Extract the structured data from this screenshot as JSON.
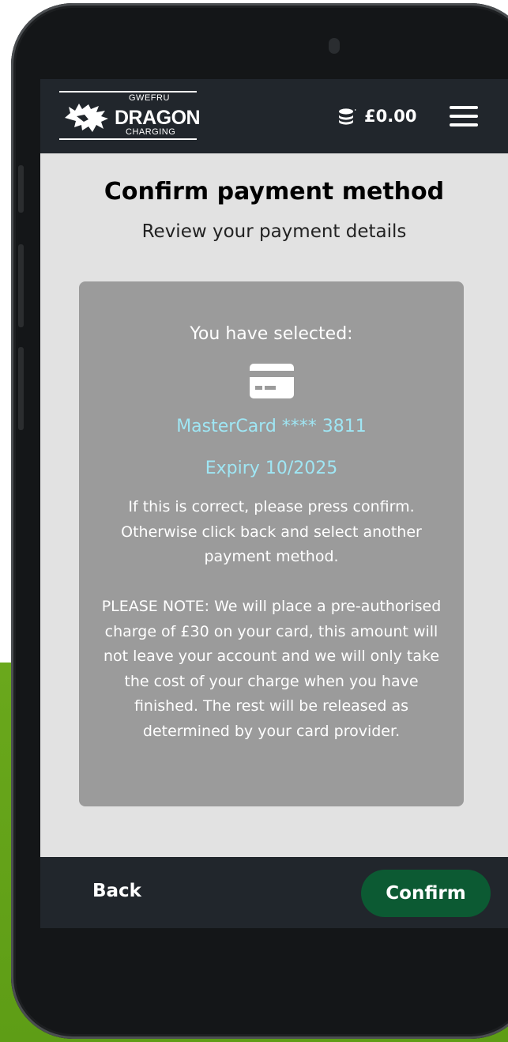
{
  "header": {
    "logo_top": "GWEFRU",
    "logo_main": "DRAGON",
    "logo_bottom": "CHARGING",
    "balance": "£0.00",
    "balance_icon": "coins-icon",
    "menu_icon": "hamburger-menu-icon"
  },
  "page": {
    "title": "Confirm payment method",
    "subtitle": "Review your payment details"
  },
  "selection": {
    "label": "You have selected:",
    "card_icon": "credit-card-icon",
    "card_name": "MasterCard **** 3811",
    "expiry": "Expiry 10/2025",
    "info": "If this is correct, please press confirm. Otherwise click back and select another payment method.",
    "note": "PLEASE NOTE: We will place a pre-authorised charge of £30 on your card, this amount will not leave your account and we will only take the cost of your charge when you have finished. The rest will be released as determined by your card provider."
  },
  "footer": {
    "back_label": "Back",
    "confirm_label": "Confirm"
  },
  "colors": {
    "bar_bg": "#21262c",
    "card_box_bg": "#9b9b9b",
    "card_text_accent": "#9fe6f4",
    "confirm_bg": "#0c5a33",
    "background_green": "#6aa81c"
  }
}
